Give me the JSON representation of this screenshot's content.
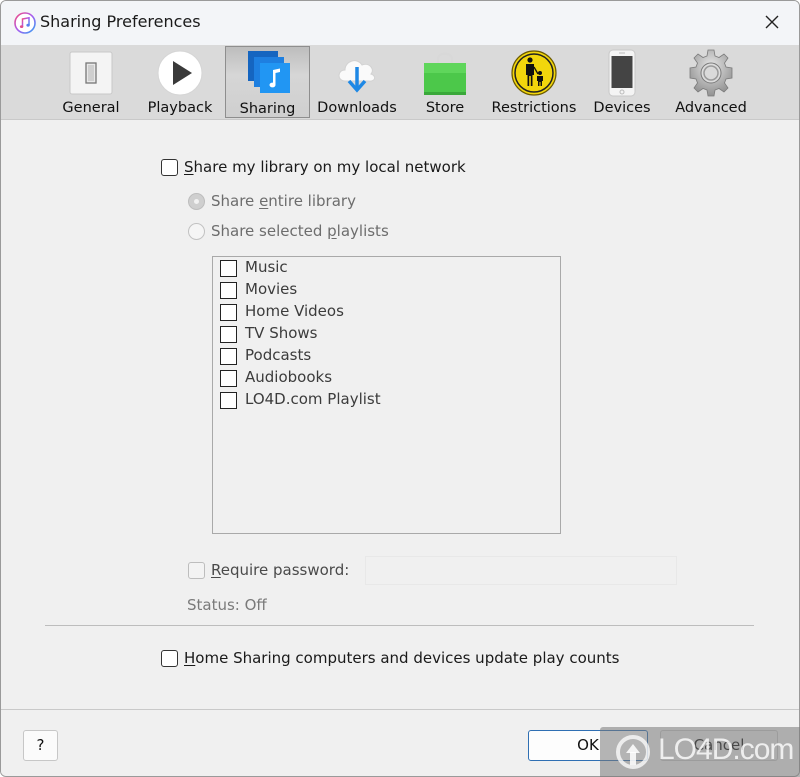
{
  "window": {
    "title": "Sharing Preferences",
    "app_icon": "itunes-icon",
    "close_icon": "close-icon"
  },
  "toolbar": {
    "items": [
      {
        "label": "General",
        "icon": "switch-icon",
        "active": false
      },
      {
        "label": "Playback",
        "icon": "play-icon",
        "active": false
      },
      {
        "label": "Sharing",
        "icon": "sharing-icon",
        "active": true
      },
      {
        "label": "Downloads",
        "icon": "cloud-download-icon",
        "active": false
      },
      {
        "label": "Store",
        "icon": "shopping-bag-icon",
        "active": false
      },
      {
        "label": "Restrictions",
        "icon": "parental-icon",
        "active": false
      },
      {
        "label": "Devices",
        "icon": "phone-icon",
        "active": false
      },
      {
        "label": "Advanced",
        "icon": "gear-icon",
        "active": false
      }
    ]
  },
  "sharing": {
    "share_library": {
      "label_first": "S",
      "label_rest": "hare my library on my local network",
      "checked": false
    },
    "share_entire": {
      "label_pre": "Share ",
      "label_u": "e",
      "label_post": "ntire library",
      "selected": true,
      "enabled": false
    },
    "share_selected": {
      "label_pre": "Share selected ",
      "label_u": "p",
      "label_post": "laylists",
      "selected": false,
      "enabled": false
    },
    "playlists": [
      {
        "label": "Music",
        "checked": false
      },
      {
        "label": "Movies",
        "checked": false
      },
      {
        "label": "Home Videos",
        "checked": false
      },
      {
        "label": "TV Shows",
        "checked": false
      },
      {
        "label": "Podcasts",
        "checked": false
      },
      {
        "label": "Audiobooks",
        "checked": false
      },
      {
        "label": "LO4D.com Playlist",
        "checked": false
      }
    ],
    "require_password": {
      "label_first": "R",
      "label_rest": "equire password:",
      "checked": false,
      "enabled": false,
      "value": ""
    },
    "status": "Status: Off",
    "update_play_counts": {
      "label_first": "H",
      "label_rest": "ome Sharing computers and devices update play counts",
      "checked": false
    }
  },
  "footer": {
    "help_label": "?",
    "ok_label": "OK",
    "cancel_label": "Cancel"
  },
  "watermark": {
    "text": "LO4D.com"
  }
}
